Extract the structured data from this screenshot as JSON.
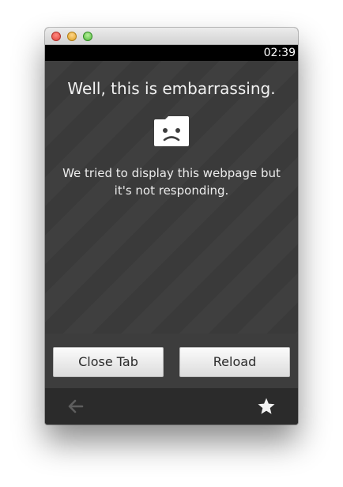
{
  "window": {
    "controls": [
      "close",
      "minimize",
      "maximize"
    ]
  },
  "status_bar": {
    "clock": "02:39"
  },
  "error_page": {
    "title": "Well, this is embarrassing.",
    "icon": "sad-folder-icon",
    "message": "We tried to display this webpage but it's not responding."
  },
  "actions": {
    "close_tab_label": "Close Tab",
    "reload_label": "Reload"
  },
  "nav_bar": {
    "back_icon": "back-arrow-icon",
    "bookmark_icon": "star-icon"
  },
  "colors": {
    "content_background": "#3d3d3d",
    "nav_bar_background": "#2b2b2b",
    "status_bar_background": "#000000",
    "text": "#f2f2f2"
  }
}
